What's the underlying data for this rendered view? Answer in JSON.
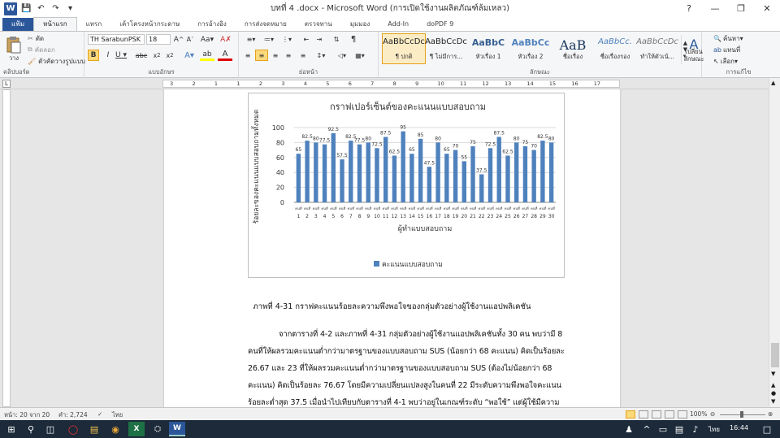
{
  "window": {
    "title": "บทที่ 4 .docx - Microsoft Word (การเปิดใช้งานผลิตภัณฑ์ล้มเหลว)",
    "qat": [
      "save-icon",
      "undo-icon",
      "redo-icon"
    ]
  },
  "tabs": [
    "แฟ้ม",
    "หน้าแรก",
    "แทรก",
    "เค้าโครงหน้ากระดาษ",
    "การอ้างอิง",
    "การส่งจดหมาย",
    "ตรวจทาน",
    "มุมมอง",
    "Add-In",
    "doPDF 9"
  ],
  "ribbon": {
    "clipboard": {
      "paste": "วาง",
      "cut": "ตัด",
      "copy": "คัดลอก",
      "format_painter": "ตัวคัดวางรูปแบบ",
      "label": "คลิปบอร์ด"
    },
    "font": {
      "name": "TH SarabunPSK",
      "size": "18",
      "label": "แบบอักษร"
    },
    "paragraph": {
      "label": "ย่อหน้า"
    },
    "styles": {
      "items": [
        {
          "preview": "AaBbCcDc",
          "name": "¶ ปกติ"
        },
        {
          "preview": "AaBbCcDc",
          "name": "¶ ไม่มีการ..."
        },
        {
          "preview": "AaBbC",
          "name": "หัวเรื่อง 1"
        },
        {
          "preview": "AaBbCc",
          "name": "หัวเรื่อง 2"
        },
        {
          "preview": "AaB",
          "name": "ชื่อเรื่อง"
        },
        {
          "preview": "AaBbCc.",
          "name": "ชื่อเรื่องรอง"
        },
        {
          "preview": "AaBbCcDc",
          "name": "ทำให้ตัวเน้..."
        }
      ],
      "change_styles": "เปลี่ยน ลักษณะ",
      "label": "ลักษณะ"
    },
    "editing": {
      "find": "ค้นหา",
      "replace": "แทนที่",
      "select": "เลือก",
      "label": "การแก้ไข"
    }
  },
  "ruler": [
    "3",
    "2",
    "1",
    "1",
    "2",
    "3",
    "4",
    "5",
    "6",
    "7",
    "8",
    "9",
    "10",
    "11",
    "12",
    "13",
    "14",
    "15",
    "16",
    "17"
  ],
  "chart_data": {
    "type": "bar",
    "title": "กราฟเปอร์เซ็นต์ของคะแนนแบบสอบถาม",
    "xlabel": "ผู้ทำแบบสอบถาม",
    "ylabel": "ร้อยละของคะแนนแบบสอบถามทั้งหมด",
    "ylim": [
      0,
      100
    ],
    "yticks": [
      0,
      20,
      40,
      60,
      80,
      100
    ],
    "grid": true,
    "legend_position": "bottom",
    "category_prefix": "คนที่",
    "categories": [
      "1",
      "2",
      "3",
      "4",
      "5",
      "6",
      "7",
      "8",
      "9",
      "10",
      "11",
      "12",
      "13",
      "14",
      "15",
      "16",
      "17",
      "18",
      "19",
      "20",
      "21",
      "22",
      "23",
      "24",
      "25",
      "26",
      "27",
      "28",
      "29",
      "30"
    ],
    "series": [
      {
        "name": "คะแนนแบบสอบถาม",
        "color": "#4f81bd",
        "values": [
          65,
          82.5,
          80,
          77.5,
          92.5,
          57.5,
          82.5,
          77.5,
          80,
          72.5,
          87.5,
          62.5,
          95,
          65,
          85,
          47.5,
          80,
          65,
          70,
          55,
          75,
          37.5,
          72.5,
          87.5,
          62.5,
          80,
          75,
          70,
          82.5,
          80
        ]
      }
    ]
  },
  "document": {
    "caption": "ภาพที่ 4-31 กราฟคะแนนร้อยละความพึงพอใจของกลุ่มตัวอย่างผู้ใช้งานแอปพลิเคชัน",
    "paragraph_lines": [
      "จากตารางที่ 4-2 และภาพที่ 4-31 กลุ่มตัวอย่างผู้ใช้งานแอปพลิเคชันทั้ง 30 คน พบว่ามี 8",
      "คนที่ให้ผลรวมคะแนนต่ำกว่ามาตรฐานของแบบสอบถาม SUS (น้อยกว่า 68 คะแนน) คิดเป็นร้อยละ",
      "26.67 และ 23 ที่ให้ผลรวมคะแนนต่ำกว่ามาตรฐานของแบบสอบถาม SUS (ต้องไม่น้อยกว่า 68",
      "คะแนน) คิดเป็นร้อยละ 76.67 โดยมีความเปลี่ยนแปลงสูงในคนที่ 22 มีระดับความพึงพอใจคะแนน",
      "ร้อยละต่ำสุด 37.5 เมื่อนำไปเทียบกับตารางที่ 4-1 พบว่าอยู่ในเกณฑ์ระดับ “พอใช้” แต่ผู้ใช้มีความ"
    ]
  },
  "status": {
    "page": "หน้า: 20 จาก 20",
    "words": "คำ: 2,724",
    "lang": "ไทย",
    "zoom": "100%"
  },
  "taskbar": {
    "lang": "ไทย",
    "time": "16:44"
  }
}
